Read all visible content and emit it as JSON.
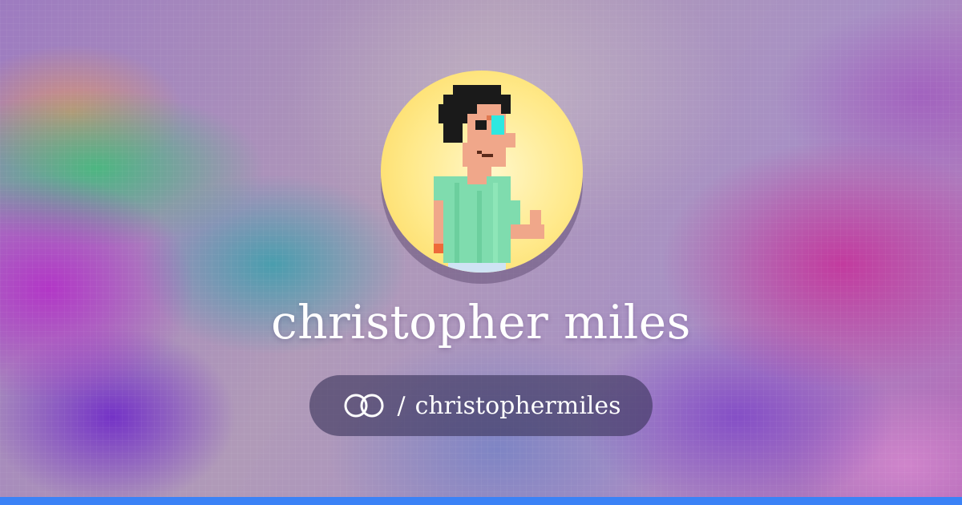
{
  "profile": {
    "name": "christopher miles",
    "separator": "/",
    "handle": "christophermiles",
    "link_icon": "link-rings-icon",
    "avatar": "pixel-art-avatar"
  },
  "colors": {
    "bottom_bar": "#3b82f6",
    "avatar_bg": "#ffe98a",
    "pill_bg": "#3a345a",
    "text": "#ffffff"
  }
}
